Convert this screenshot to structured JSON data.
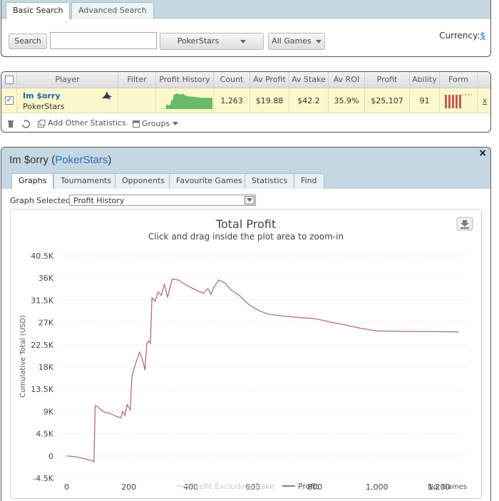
{
  "search": {
    "tabs": [
      "Basic Search",
      "Advanced Search"
    ],
    "search_button": "Search",
    "query_value": "",
    "site_select": "PokerStars",
    "games_select": "All Games",
    "currency_label": "Currency:",
    "currency_symbol": "$"
  },
  "results": {
    "columns": [
      "Player",
      "Filter",
      "Profit History",
      "Count",
      "Av Profit",
      "Av Stake",
      "Av ROI",
      "Profit",
      "Ability",
      "Form"
    ],
    "row": {
      "player_name": "Im $orry",
      "player_site": "PokerStars",
      "count": "1,263",
      "av_profit": "$19.88",
      "av_stake": "$42.2",
      "av_roi": "35.9%",
      "profit": "$25,107",
      "ability": "91",
      "remove": "x"
    },
    "footer": {
      "add_stats": "Add Other Statistics",
      "groups": "Groups"
    }
  },
  "player": {
    "name": "Im $orry",
    "site_open": "(",
    "site": "PokerStars",
    "site_close": ")",
    "close": "×",
    "tabs": [
      "Graphs",
      "Tournaments",
      "Opponents",
      "Favourite Games",
      "Statistics",
      "Find"
    ],
    "graph_selected_label": "Graph Selected:",
    "graph_selected_value": "Profit History"
  },
  "colors": {
    "profit_line": "#b07070",
    "profit_ex_rake_line": "#e0e0e0",
    "sparkline_fill": "#69b969",
    "form_bar": "#c75757",
    "link_blue": "#2a6cc2"
  },
  "chart_data": {
    "type": "line",
    "title": "Total Profit",
    "subtitle": "Click and drag inside the plot area to zoom-in",
    "ylabel": "Cumulative Total (USD)",
    "xlabel": "No. Games",
    "ylim": [
      -4500,
      40500
    ],
    "xlim": [
      -15,
      1290
    ],
    "y_ticks": [
      -4500,
      0,
      4500,
      9000,
      13500,
      18000,
      22500,
      27000,
      31500,
      36000,
      40500
    ],
    "y_tick_labels": [
      "-4.5K",
      "0",
      "4.5K",
      "9K",
      "13.5K",
      "18K",
      "22.5K",
      "27K",
      "31.5K",
      "36K",
      "40.5K"
    ],
    "x_ticks": [
      0,
      200,
      400,
      600,
      800,
      1000,
      1200
    ],
    "x_tick_labels": [
      "0",
      "200",
      "400",
      "600",
      "800",
      "1,000",
      "1,200"
    ],
    "grid": true,
    "legend_position": "bottom",
    "series": [
      {
        "name": "Profit Excluding Rake",
        "points": []
      },
      {
        "name": "Profit",
        "points": [
          [
            0,
            0
          ],
          [
            20,
            -100
          ],
          [
            40,
            -300
          ],
          [
            60,
            -600
          ],
          [
            80,
            -900
          ],
          [
            88,
            -1200
          ],
          [
            92,
            10200
          ],
          [
            100,
            10000
          ],
          [
            110,
            9300
          ],
          [
            125,
            8800
          ],
          [
            140,
            8600
          ],
          [
            160,
            8000
          ],
          [
            175,
            7700
          ],
          [
            180,
            9000
          ],
          [
            188,
            8200
          ],
          [
            195,
            10400
          ],
          [
            205,
            9300
          ],
          [
            210,
            16000
          ],
          [
            222,
            18700
          ],
          [
            235,
            21000
          ],
          [
            245,
            19400
          ],
          [
            252,
            17400
          ],
          [
            258,
            22600
          ],
          [
            265,
            23300
          ],
          [
            270,
            22800
          ],
          [
            275,
            32000
          ],
          [
            285,
            31300
          ],
          [
            295,
            33200
          ],
          [
            305,
            32500
          ],
          [
            315,
            34800
          ],
          [
            325,
            32100
          ],
          [
            340,
            35800
          ],
          [
            360,
            35600
          ],
          [
            380,
            34800
          ],
          [
            400,
            34100
          ],
          [
            420,
            33500
          ],
          [
            440,
            32900
          ],
          [
            455,
            33900
          ],
          [
            465,
            32700
          ],
          [
            475,
            34200
          ],
          [
            490,
            35600
          ],
          [
            510,
            35000
          ],
          [
            530,
            33600
          ],
          [
            560,
            32300
          ],
          [
            590,
            30500
          ],
          [
            620,
            29400
          ],
          [
            650,
            28700
          ],
          [
            700,
            28300
          ],
          [
            750,
            28000
          ],
          [
            800,
            27800
          ],
          [
            850,
            27100
          ],
          [
            900,
            26500
          ],
          [
            950,
            25800
          ],
          [
            1000,
            25300
          ],
          [
            1100,
            25200
          ],
          [
            1200,
            25150
          ],
          [
            1263,
            25107
          ]
        ]
      }
    ]
  }
}
